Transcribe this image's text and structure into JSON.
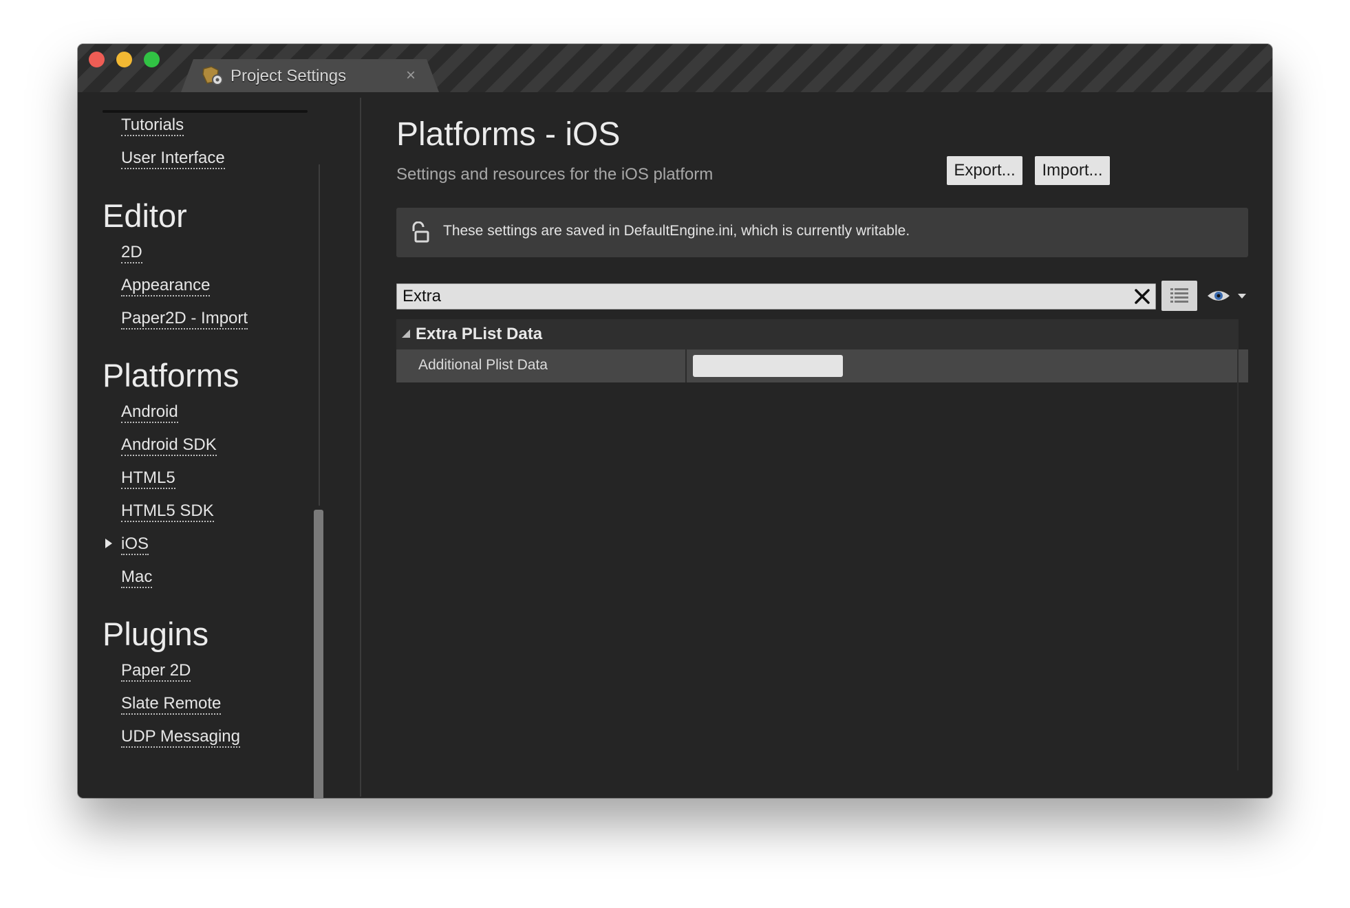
{
  "window": {
    "tab_title": "Project Settings",
    "tab_close": "×"
  },
  "sidebar": {
    "top_items": [
      {
        "label": "Tutorials"
      },
      {
        "label": "User Interface"
      }
    ],
    "sections": [
      {
        "heading": "Editor",
        "items": [
          {
            "label": "2D"
          },
          {
            "label": "Appearance"
          },
          {
            "label": "Paper2D - Import"
          }
        ]
      },
      {
        "heading": "Platforms",
        "items": [
          {
            "label": "Android"
          },
          {
            "label": "Android SDK"
          },
          {
            "label": "HTML5"
          },
          {
            "label": "HTML5 SDK"
          },
          {
            "label": "iOS"
          },
          {
            "label": "Mac"
          }
        ]
      },
      {
        "heading": "Plugins",
        "items": [
          {
            "label": "Paper 2D"
          },
          {
            "label": "Slate Remote"
          },
          {
            "label": "UDP Messaging"
          }
        ]
      }
    ],
    "selected": "iOS"
  },
  "main": {
    "title": "Platforms - iOS",
    "subtitle": "Settings and resources for the iOS platform",
    "export_label": "Export...",
    "import_label": "Import...",
    "info_text": "These settings are saved in DefaultEngine.ini, which is currently writable.",
    "search_value": "Extra",
    "category_label": "Extra PList Data",
    "property_label": "Additional Plist Data",
    "property_value": ""
  },
  "icons": {
    "tab": "settings-gear-icon",
    "lock": "unlocked-padlock-icon",
    "clear": "close-icon",
    "view": "list-view-icon",
    "visibility": "eye-icon"
  }
}
